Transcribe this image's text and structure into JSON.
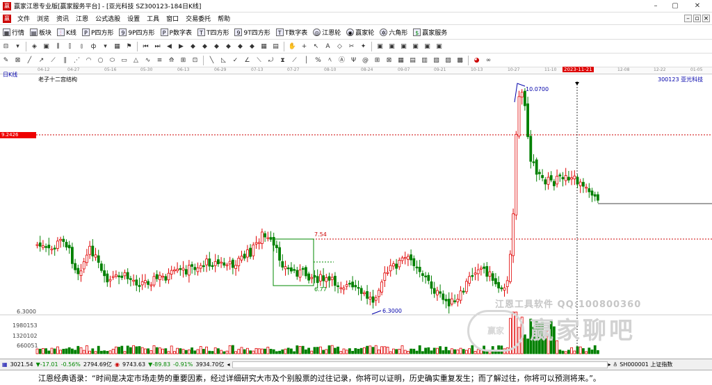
{
  "window": {
    "title": "赢家江恩专业版[赢家服务平台] - [亚光科技  SZ300123-184日K线]",
    "app_icon": "赢"
  },
  "menu": [
    "文件",
    "浏览",
    "资讯",
    "江恩",
    "公式选股",
    "设置",
    "工具",
    "窗口",
    "交易委托",
    "帮助"
  ],
  "toolbar1": [
    {
      "label": "行情",
      "icon": "grid-icon"
    },
    {
      "label": "板块",
      "icon": "blocks-icon"
    },
    {
      "label": "K线",
      "icon": "kline-icon"
    },
    {
      "label": "P四方形",
      "icon": "p-square-icon"
    },
    {
      "label": "9P四方形",
      "icon": "9p-square-icon"
    },
    {
      "label": "P数字表",
      "icon": "p-table-icon"
    },
    {
      "label": "T四方形",
      "icon": "t-square-icon"
    },
    {
      "label": "9T四方形",
      "icon": "9t-square-icon"
    },
    {
      "label": "T数字表",
      "icon": "t-table-icon"
    },
    {
      "label": "江恩轮",
      "icon": "gann-wheel-icon"
    },
    {
      "label": "赢家轮",
      "icon": "winner-wheel-icon"
    },
    {
      "label": "六角形",
      "icon": "hexagon-icon"
    },
    {
      "label": "赢家服务",
      "icon": "dollar-icon"
    }
  ],
  "timeline": {
    "dates": [
      "04-12",
      "04-27",
      "05-16",
      "05-30",
      "06-13",
      "06-29",
      "07-13",
      "07-27",
      "08-10",
      "08-24",
      "09-07",
      "09-21",
      "10-13",
      "10-27",
      "11-10",
      "12-08",
      "12-22",
      "01-05"
    ],
    "cursor_date": "2023-11-21"
  },
  "chart": {
    "period_label": "日K线",
    "indicator_label": "老子十二宫结构",
    "stock_label": "300123  亚光科技",
    "price_tag": "9.2426",
    "high_label": "10.0700",
    "low_label": "6.3000",
    "box_top_label": "7.54",
    "box_bottom_label": "6.77",
    "axis_price": "6.3000",
    "vol_labels": [
      "1980153",
      "1320102",
      "660051"
    ],
    "up_color": "#e00000",
    "down_color": "#008000"
  },
  "watermark": {
    "line1": "江恩工具软件  QQ:100800360",
    "brand": "赢家聊吧",
    "logo": "赢家"
  },
  "status": {
    "sh_index": "3021.54",
    "sh_change": "▼-17.01",
    "sh_pct": "-0.56%",
    "sh_amount": "2794.69亿",
    "sz_index": "9743.63",
    "sz_change": "▼-89.83",
    "sz_pct": "-0.91%",
    "sz_amount": "3934.70亿",
    "ticker": "SH000001 上证指数"
  },
  "footer": "江恩经典语录：“时间是决定市场走势的重要因素，经过详细研究大市及个别股票的过往记录，你将可以证明，历史确实重复发生；而了解过往，你将可以预测将来。”。"
}
